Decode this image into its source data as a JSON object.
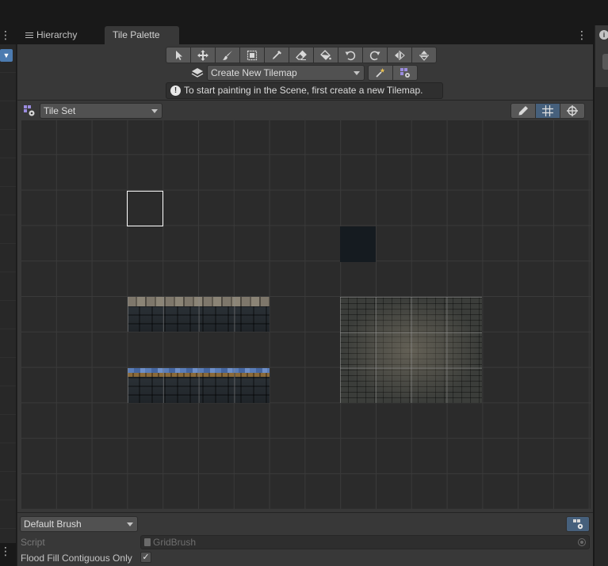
{
  "tabs": {
    "hierarchy": "Hierarchy",
    "tile_palette": "Tile Palette"
  },
  "toolbar": {
    "tools": [
      {
        "name": "select-tool",
        "icon": "arrow-pointer-icon"
      },
      {
        "name": "move-tool",
        "icon": "move-arrows-icon"
      },
      {
        "name": "paint-tool",
        "icon": "brush-icon"
      },
      {
        "name": "box-fill-tool",
        "icon": "box-fill-icon"
      },
      {
        "name": "pick-tool",
        "icon": "eyedropper-icon"
      },
      {
        "name": "erase-tool",
        "icon": "eraser-icon"
      },
      {
        "name": "flood-fill-tool",
        "icon": "bucket-icon"
      },
      {
        "name": "rotate-ccw-tool",
        "icon": "rotate-ccw-icon"
      },
      {
        "name": "rotate-cw-tool",
        "icon": "rotate-cw-icon"
      },
      {
        "name": "flip-x-tool",
        "icon": "flip-horizontal-icon"
      },
      {
        "name": "flip-y-tool",
        "icon": "flip-vertical-icon"
      }
    ]
  },
  "tilemap": {
    "selected": "Create New Tilemap"
  },
  "hint": "To start painting in the Scene, first create a new Tilemap.",
  "palette": {
    "selected": "Tile Set"
  },
  "brush": {
    "selected": "Default Brush",
    "script_label": "Script",
    "script_value": "GridBrush",
    "flood_fill_label": "Flood Fill Contiguous Only",
    "flood_fill_checked": "✓"
  },
  "colors": {
    "panel_bg": "#383838",
    "grid_bg": "#2b2b2b",
    "active_button": "#46607c",
    "selection": "#ffffff"
  }
}
